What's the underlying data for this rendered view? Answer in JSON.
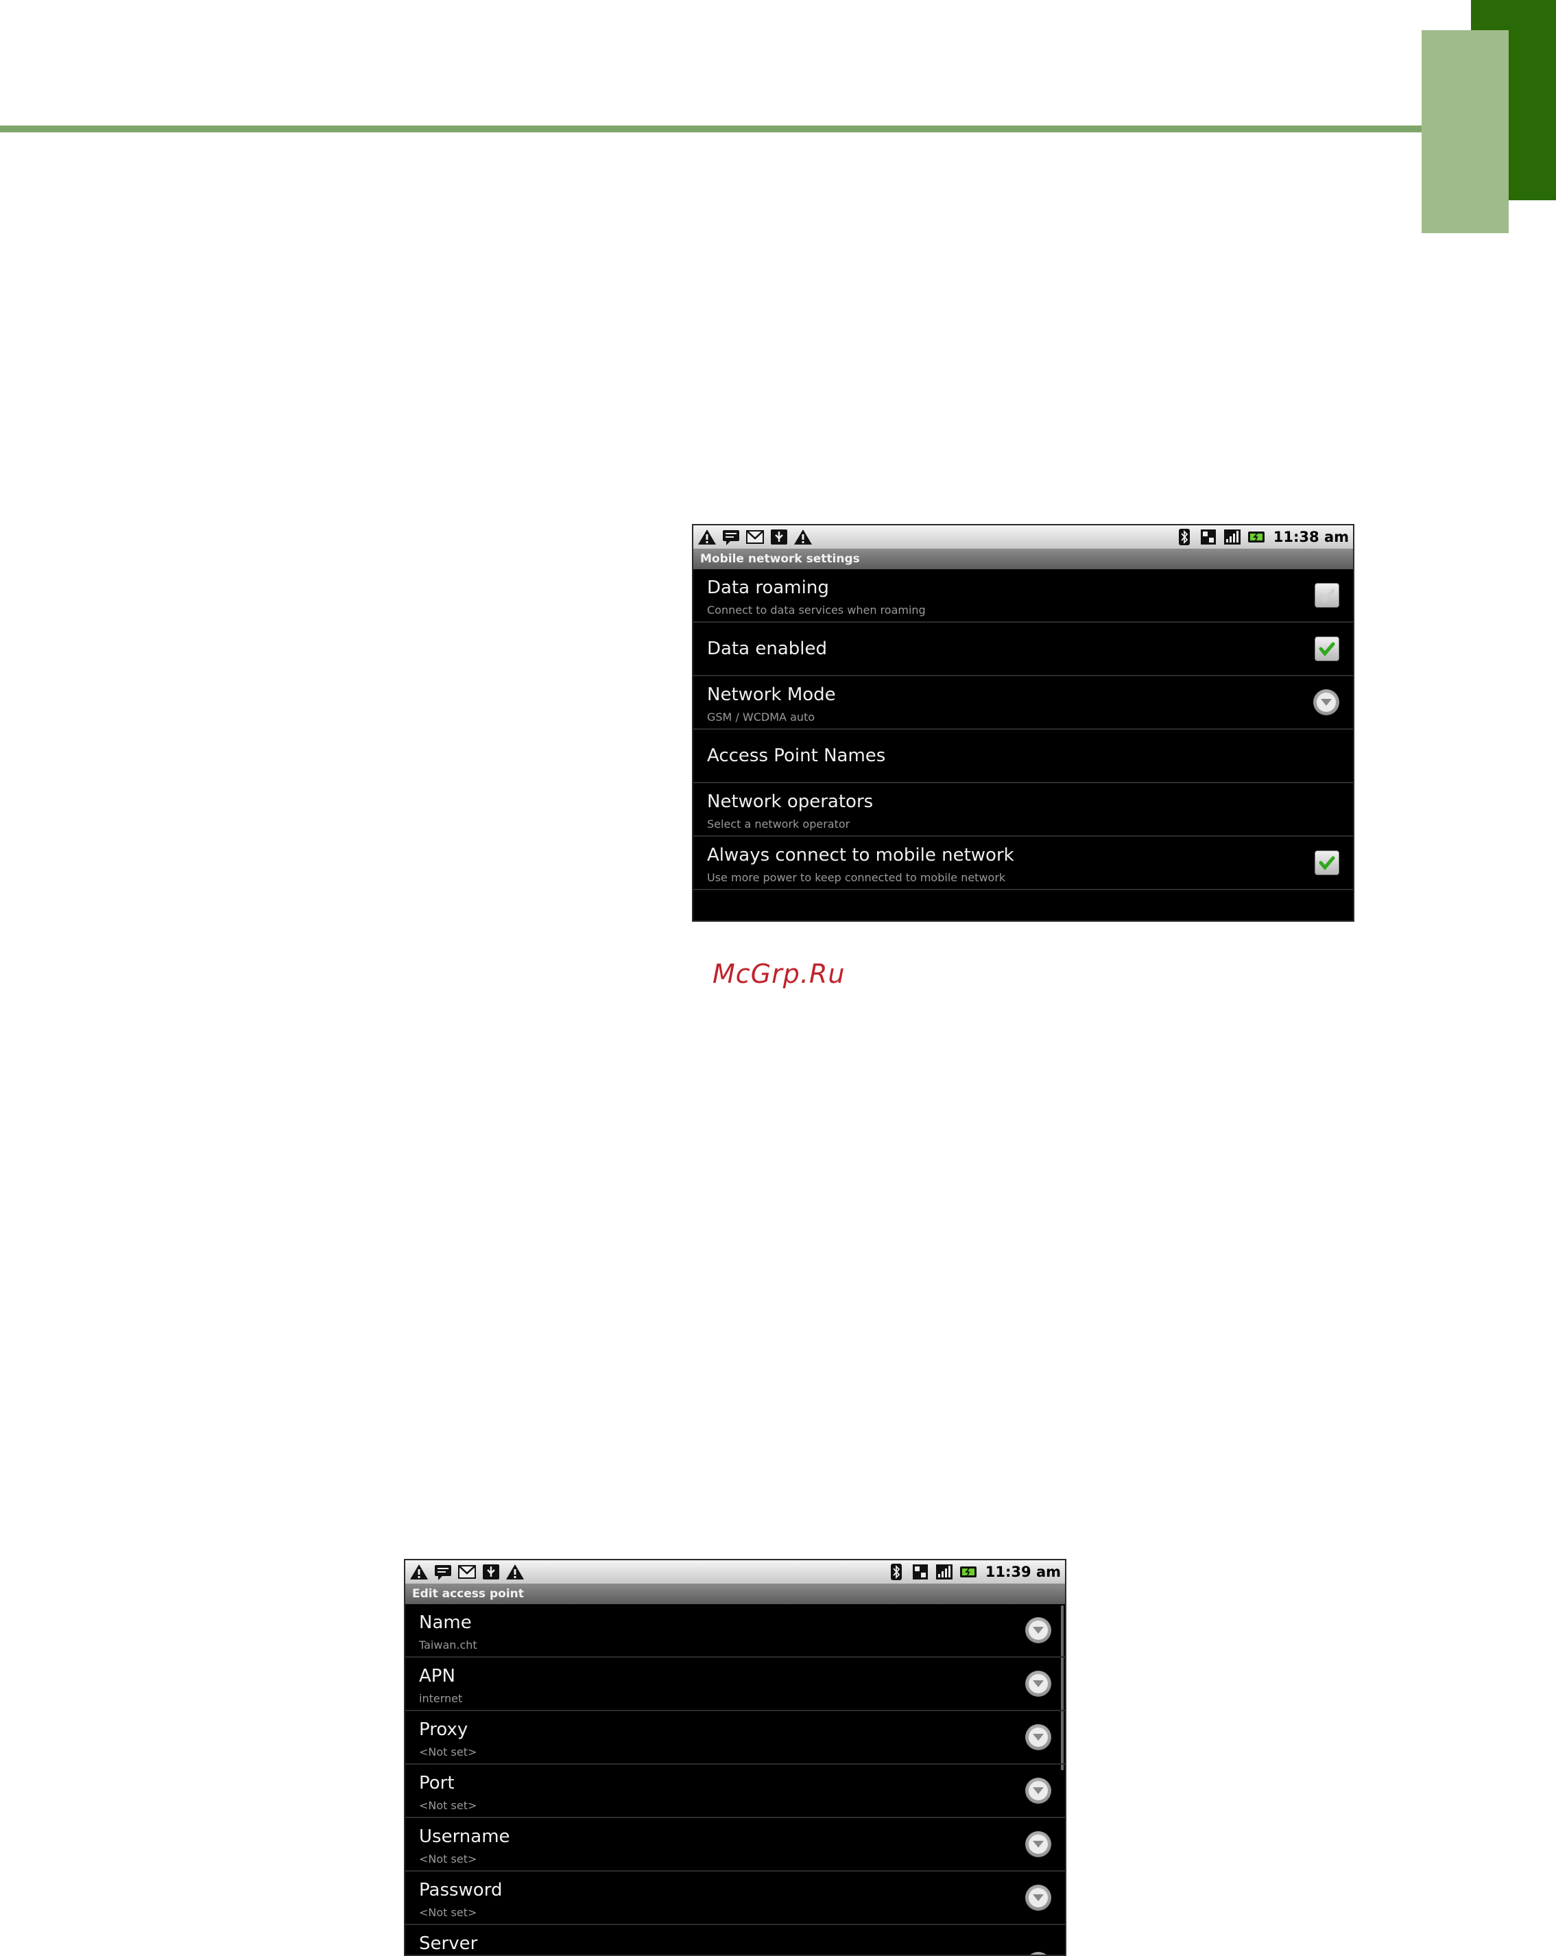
{
  "page": {
    "watermark": "McGrp.Ru"
  },
  "screen1": {
    "status": {
      "time": "11:38 am",
      "left_icons": [
        "warning-icon",
        "message-icon",
        "gmail-icon",
        "usb-icon",
        "warning-icon"
      ],
      "right_icons": [
        "bluetooth-icon",
        "data-icon",
        "signal-icon",
        "battery-icon"
      ]
    },
    "title": "Mobile network settings",
    "items": [
      {
        "title": "Data roaming",
        "summary": "Connect to data services when roaming",
        "control": "checkbox",
        "checked": false
      },
      {
        "title": "Data enabled",
        "summary": "",
        "control": "checkbox",
        "checked": true
      },
      {
        "title": "Network Mode",
        "summary": "GSM / WCDMA auto",
        "control": "dropdown"
      },
      {
        "title": "Access Point Names",
        "summary": "",
        "control": "none"
      },
      {
        "title": "Network operators",
        "summary": "Select a network operator",
        "control": "none"
      },
      {
        "title": "Always connect to mobile network",
        "summary": "Use more power to keep connected to mobile network",
        "control": "checkbox",
        "checked": true
      }
    ]
  },
  "screen2": {
    "status": {
      "time": "11:39 am"
    },
    "title": "Edit access point",
    "items": [
      {
        "title": "Name",
        "summary": "Taiwan.cht",
        "control": "dropdown"
      },
      {
        "title": "APN",
        "summary": "internet",
        "control": "dropdown"
      },
      {
        "title": "Proxy",
        "summary": "<Not set>",
        "control": "dropdown"
      },
      {
        "title": "Port",
        "summary": "<Not set>",
        "control": "dropdown"
      },
      {
        "title": "Username",
        "summary": "<Not set>",
        "control": "dropdown"
      },
      {
        "title": "Password",
        "summary": "<Not set>",
        "control": "dropdown"
      },
      {
        "title": "Server",
        "summary": "",
        "control": "dropdown"
      }
    ]
  },
  "colors": {
    "accent_dark": "#2a6a06",
    "accent_light": "#9fbb8b",
    "rule": "#7fa66a",
    "watermark": "#c0232b",
    "check": "#2fa81c"
  }
}
